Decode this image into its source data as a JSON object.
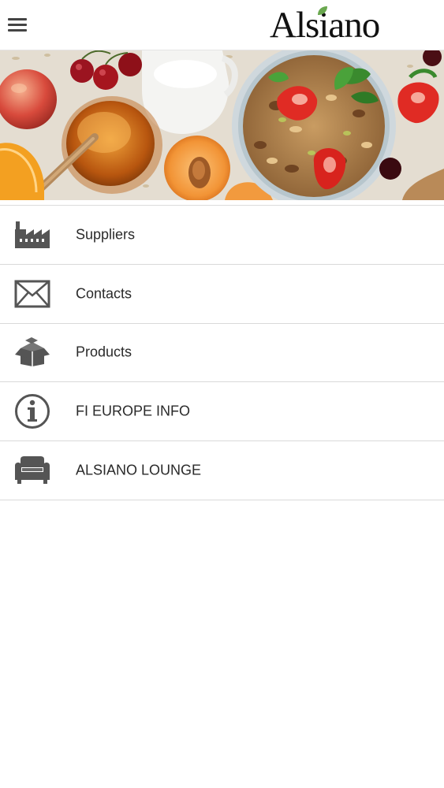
{
  "app": {
    "brand": "Alsiano",
    "brand_color": "#111111",
    "leaf_color": "#6aa84f"
  },
  "header": {
    "menu_icon": "hamburger-menu-icon"
  },
  "hero": {
    "description_icon": "food-banner-image"
  },
  "menu": {
    "items": [
      {
        "label": "Suppliers",
        "icon": "factory-icon"
      },
      {
        "label": "Contacts",
        "icon": "envelope-icon"
      },
      {
        "label": "Products",
        "icon": "open-box-icon"
      },
      {
        "label": "FI EUROPE INFO",
        "icon": "info-circle-icon"
      },
      {
        "label": "ALSIANO LOUNGE",
        "icon": "sofa-icon"
      }
    ]
  }
}
